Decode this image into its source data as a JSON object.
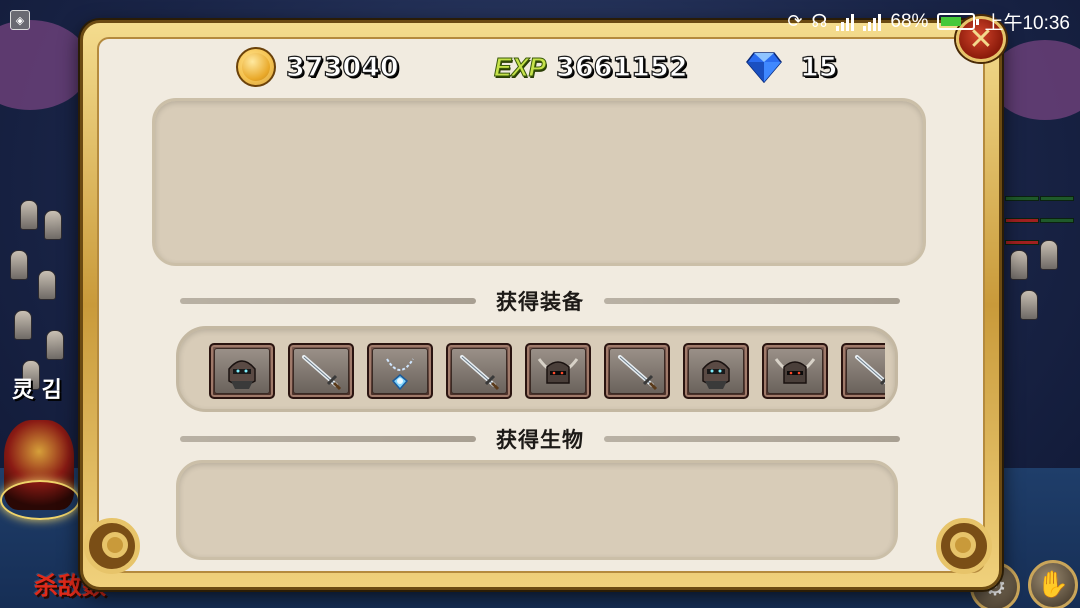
{
  "status_bar": {
    "battery_percent": "68%",
    "time": "上午10:36",
    "battery_level": 0.68,
    "icons": [
      "app-badge-icon",
      "rotate-lock-icon",
      "headset-icon",
      "signal-icon",
      "signal-icon",
      "battery-icon"
    ]
  },
  "background": {
    "kill_label": "杀敌数",
    "side_text": "灵 김"
  },
  "currency": {
    "gold": "373040",
    "exp_label": "EXP",
    "exp": "3661152",
    "gems": "15"
  },
  "sections": {
    "equipment_title": "获得装备",
    "creatures_title": "获得生物"
  },
  "equipment_items": [
    {
      "icon": "masked-helmet-icon"
    },
    {
      "icon": "sword-icon"
    },
    {
      "icon": "amulet-icon"
    },
    {
      "icon": "sword-icon"
    },
    {
      "icon": "horned-helmet-icon"
    },
    {
      "icon": "sword-icon"
    },
    {
      "icon": "masked-helmet-icon"
    },
    {
      "icon": "horned-helmet-icon"
    },
    {
      "icon": "sword-icon"
    }
  ],
  "colors": {
    "panel_gold": "#c99a3a",
    "panel_bg": "#f1ebe0",
    "box_bg": "#d8ccb8",
    "kill_text": "#e02a1a",
    "exp_green": "#c6e24a"
  }
}
